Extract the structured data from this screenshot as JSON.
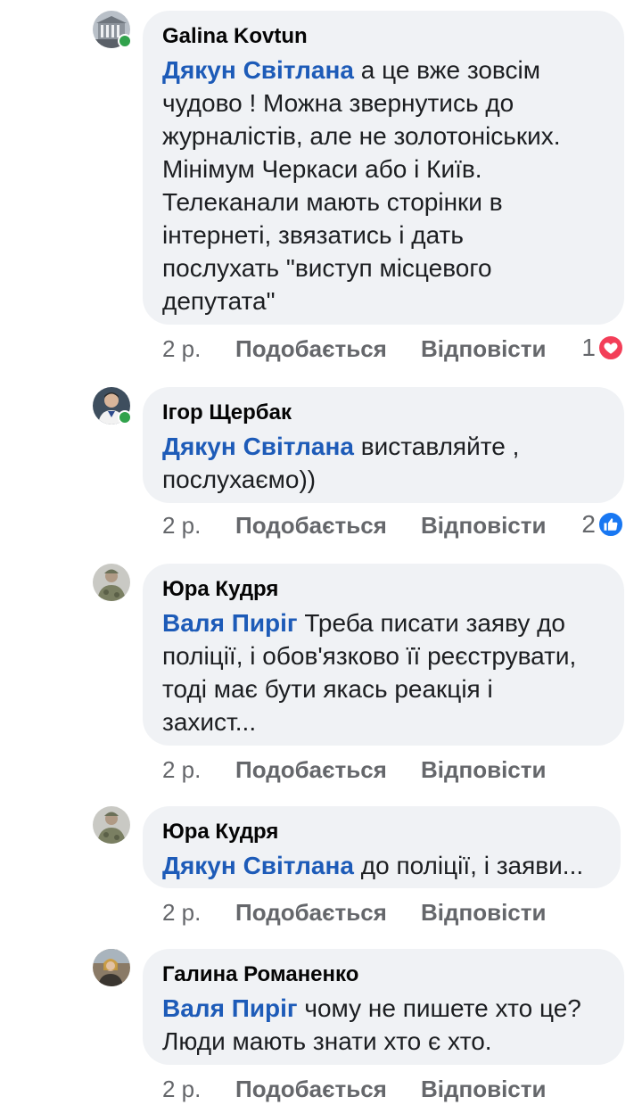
{
  "comments": [
    {
      "author": "Galina Kovtun",
      "mention": "Дякун Світлана",
      "text": "а це вже зовсім\nчудово ! Можна звернутись до\nжурналістів, але не золотоніських.\nМінімум Черкаси або і Київ.\nТелеканали мають сторінки в\nінтернеті, звязатись і дать\nпослухать \"виступ місцевого\nдепутата\"",
      "time": "2 р.",
      "like_label": "Подобається",
      "reply_label": "Відповісти",
      "reaction_count": "1",
      "reaction_icon": "love-icon",
      "online": true
    },
    {
      "author": "Ігор Щербак",
      "mention": "Дякун Світлана",
      "text": "виставляйте ,\nпослухаємо))",
      "time": "2 р.",
      "like_label": "Подобається",
      "reply_label": "Відповісти",
      "reaction_count": "2",
      "reaction_icon": "like-icon",
      "online": true
    },
    {
      "author": "Юра Кудря",
      "mention": "Валя Пиріг",
      "text": "Треба писати заяву до\nполіції, і обов'язково її реєструвати,\nтоді має бути якась реакція і\nзахист...",
      "time": "2 р.",
      "like_label": "Подобається",
      "reply_label": "Відповісти"
    },
    {
      "author": "Юра Кудря",
      "mention": "Дякун Світлана",
      "text": "до поліції, і заяви...",
      "time": "2 р.",
      "like_label": "Подобається",
      "reply_label": "Відповісти"
    },
    {
      "author": "Галина Романенко",
      "mention": "Валя Пиріг",
      "text": "чому не пишете хто це?\nЛюди мають знати хто є хто.",
      "time": "2 р.",
      "like_label": "Подобається",
      "reply_label": "Відповісти"
    }
  ],
  "colors": {
    "mention": "#1d5bb8",
    "bubble": "#f0f2f5",
    "meta": "#65676b",
    "love": "#f33e58",
    "like": "#1877f2",
    "online": "#31a24c"
  }
}
